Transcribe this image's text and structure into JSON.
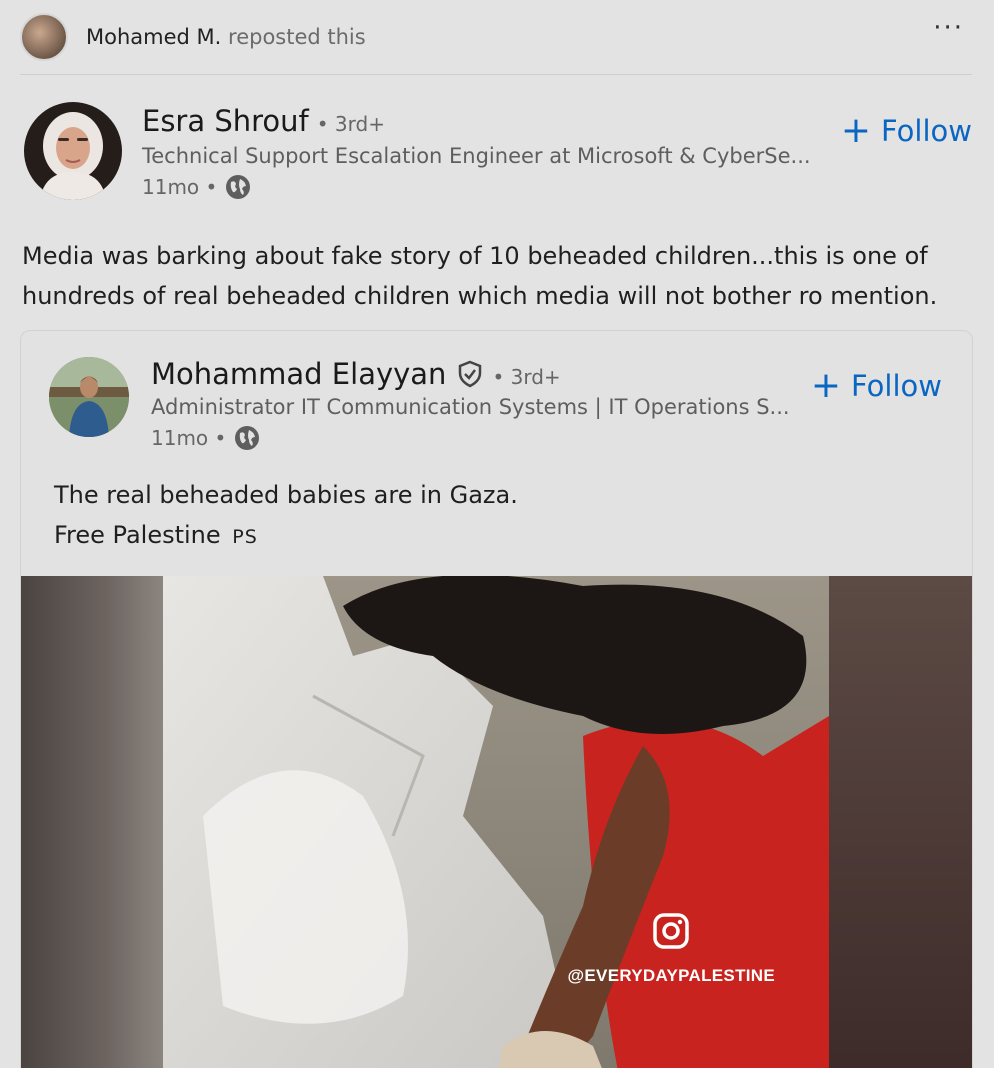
{
  "repost": {
    "name": "Mohamed M.",
    "verb": "reposted this",
    "more_label": "···"
  },
  "author": {
    "name": "Esra Shrouf",
    "degree": "• 3rd+",
    "headline": "Technical Support Escalation Engineer at Microsoft & CyberSe...",
    "time": "11mo •",
    "follow_label": "Follow",
    "follow_icon": "plus-icon",
    "visibility_icon": "globe-icon"
  },
  "post": {
    "lines": [
      "Media was barking about fake story of 10 beheaded children...this is one of",
      "hundreds of real beheaded children which media will not bother ro mention."
    ]
  },
  "embedded": {
    "author": {
      "name": "Mohammad Elayyan",
      "badge_icon": "verified-shield-icon",
      "degree": "• 3rd+",
      "headline": "Administrator IT Communication Systems | IT Operations S...",
      "time": "11mo •",
      "follow_label": "Follow"
    },
    "text": {
      "line1": "The real beheaded babies are in Gaza.",
      "line2": "Free Palestine",
      "flag": "PS"
    },
    "media": {
      "watermark": "@EVERYDAYPALESTINE",
      "watermark_icon": "instagram-icon"
    }
  },
  "colors": {
    "background": "#e3e3e3",
    "accent": "#0a66c2",
    "shirt_red": "#c8231e"
  }
}
